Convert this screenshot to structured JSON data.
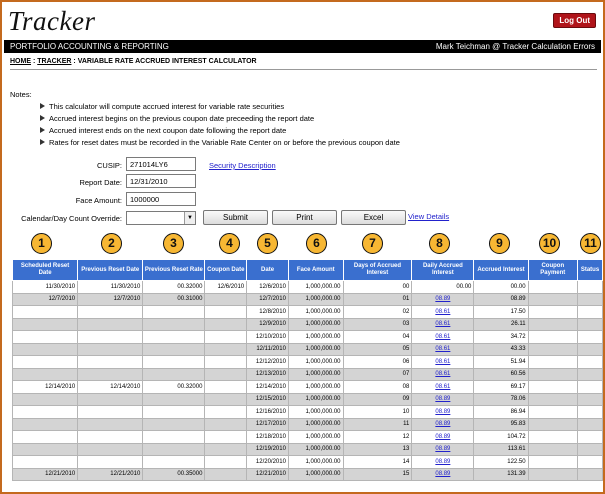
{
  "app": {
    "title": "Tracker",
    "logout_label": "Log Out"
  },
  "topbar": {
    "left": "PORTFOLIO ACCOUNTING & REPORTING",
    "right": "Mark Teichman @ Tracker Calculation Errors"
  },
  "breadcrumb": {
    "home": "HOME",
    "sep1": " : ",
    "tracker": "TRACKER",
    "current": " : VARIABLE RATE ACCRUED INTEREST CALCULATOR"
  },
  "notes": {
    "title": "Notes:",
    "items": [
      "This calculator will compute accrued interest for variable rate securities",
      "Accrued interest begins on the previous coupon date preceeding the report date",
      "Accrued interest ends on the next coupon date following the report date",
      "Rates for reset dates must be recorded in the Variable Rate Center on or before the previous coupon date"
    ]
  },
  "form": {
    "cusip_label": "CUSIP:",
    "cusip_value": "271014LY6",
    "security_link": "Security Description",
    "report_date_label": "Report Date:",
    "report_date_value": "12/31/2010",
    "face_amount_label": "Face Amount:",
    "face_amount_value": "1000000",
    "override_label": "Calendar/Day Count Override:",
    "override_value": "",
    "submit_label": "Submit",
    "print_label": "Print",
    "excel_label": "Excel",
    "view_details": "View Details"
  },
  "markers": [
    "1",
    "2",
    "3",
    "4",
    "5",
    "6",
    "7",
    "8",
    "9",
    "10",
    "11"
  ],
  "table": {
    "headers": [
      "Scheduled Reset Date",
      "Previous Reset Date",
      "Previous Reset Rate",
      "Coupon Date",
      "Date",
      "Face Amount",
      "Days of Accrued Interest",
      "Daily Accrued Interest",
      "Accrued Interest",
      "Coupon Payment",
      "Status"
    ],
    "rows": [
      [
        "11/30/2010",
        "11/30/2010",
        "00.32000",
        "12/6/2010",
        "12/6/2010",
        "1,000,000.00",
        "00",
        "00.00",
        "00.00",
        "",
        ""
      ],
      [
        "12/7/2010",
        "12/7/2010",
        "00.31000",
        "",
        "12/7/2010",
        "1,000,000.00",
        "01",
        "08.89",
        "08.89",
        "",
        ""
      ],
      [
        "",
        "",
        "",
        "",
        "12/8/2010",
        "1,000,000.00",
        "02",
        "08.61",
        "17.50",
        "",
        ""
      ],
      [
        "",
        "",
        "",
        "",
        "12/9/2010",
        "1,000,000.00",
        "03",
        "08.61",
        "26.11",
        "",
        ""
      ],
      [
        "",
        "",
        "",
        "",
        "12/10/2010",
        "1,000,000.00",
        "04",
        "08.61",
        "34.72",
        "",
        ""
      ],
      [
        "",
        "",
        "",
        "",
        "12/11/2010",
        "1,000,000.00",
        "05",
        "08.61",
        "43.33",
        "",
        ""
      ],
      [
        "",
        "",
        "",
        "",
        "12/12/2010",
        "1,000,000.00",
        "06",
        "08.61",
        "51.94",
        "",
        ""
      ],
      [
        "",
        "",
        "",
        "",
        "12/13/2010",
        "1,000,000.00",
        "07",
        "08.61",
        "60.56",
        "",
        ""
      ],
      [
        "12/14/2010",
        "12/14/2010",
        "00.32000",
        "",
        "12/14/2010",
        "1,000,000.00",
        "08",
        "08.61",
        "69.17",
        "",
        ""
      ],
      [
        "",
        "",
        "",
        "",
        "12/15/2010",
        "1,000,000.00",
        "09",
        "08.89",
        "78.06",
        "",
        ""
      ],
      [
        "",
        "",
        "",
        "",
        "12/16/2010",
        "1,000,000.00",
        "10",
        "08.89",
        "86.94",
        "",
        ""
      ],
      [
        "",
        "",
        "",
        "",
        "12/17/2010",
        "1,000,000.00",
        "11",
        "08.89",
        "95.83",
        "",
        ""
      ],
      [
        "",
        "",
        "",
        "",
        "12/18/2010",
        "1,000,000.00",
        "12",
        "08.89",
        "104.72",
        "",
        ""
      ],
      [
        "",
        "",
        "",
        "",
        "12/19/2010",
        "1,000,000.00",
        "13",
        "08.89",
        "113.61",
        "",
        ""
      ],
      [
        "",
        "",
        "",
        "",
        "12/20/2010",
        "1,000,000.00",
        "14",
        "08.89",
        "122.50",
        "",
        ""
      ],
      [
        "12/21/2010",
        "12/21/2010",
        "00.35000",
        "",
        "12/21/2010",
        "1,000,000.00",
        "15",
        "08.89",
        "131.39",
        "",
        ""
      ]
    ]
  }
}
